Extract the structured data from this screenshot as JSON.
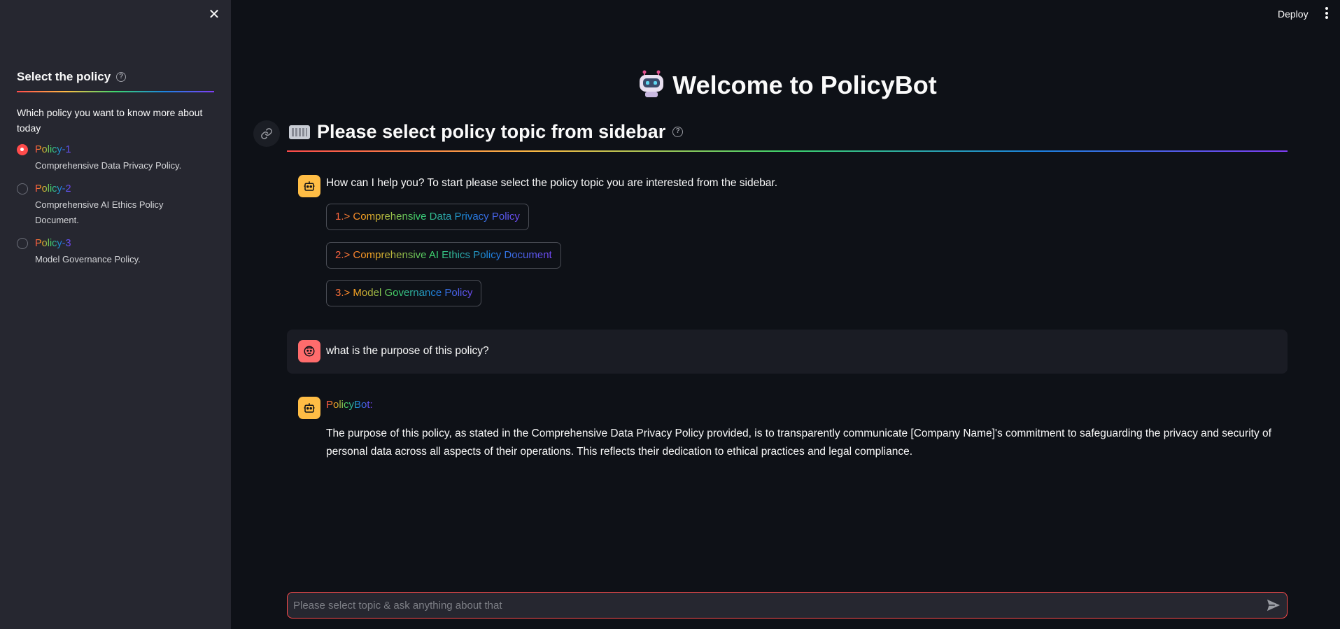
{
  "sidebar": {
    "close_label": "✕",
    "title": "Select the policy",
    "question": "Which policy you want to know more about today",
    "options": [
      {
        "label": "Policy-1",
        "caption": "Comprehensive Data Privacy Policy.",
        "selected": true
      },
      {
        "label": "Policy-2",
        "caption": "Comprehensive AI Ethics Policy Document.",
        "selected": false
      },
      {
        "label": "Policy-3",
        "caption": "Model Governance Policy.",
        "selected": false
      }
    ]
  },
  "topbar": {
    "deploy_label": "Deploy"
  },
  "main": {
    "title": "Welcome to PolicyBot",
    "subtitle": "Please select policy topic from sidebar"
  },
  "chat": {
    "greeting": "How can I help you? To start please select the policy topic you are interested from the sidebar.",
    "topics": [
      "1.> Comprehensive Data Privacy Policy",
      "2.> Comprehensive AI Ethics Policy Document",
      "3.> Model Governance Policy"
    ],
    "user_message": "what is the purpose of this policy?",
    "bot_name": "PolicyBot:",
    "bot_answer": "The purpose of this policy, as stated in the Comprehensive Data Privacy Policy provided, is to transparently communicate [Company Name]'s commitment to safeguarding the privacy and security of personal data across all aspects of their operations. This reflects their dedication to ethical practices and legal compliance."
  },
  "input": {
    "placeholder": "Please select topic & ask anything about that",
    "value": ""
  },
  "colors": {
    "accent": "#ff4b4b",
    "bot_avatar": "#ffbd45",
    "user_avatar": "#ff6c6c",
    "sidebar_bg": "#262730",
    "main_bg": "#0e1117"
  },
  "icons": {
    "close": "close-icon",
    "help": "help-icon",
    "link": "link-icon",
    "keyboard": "keyboard-icon",
    "robot": "robot-icon",
    "bot_avatar": "bot-avatar-icon",
    "user_avatar": "user-avatar-icon",
    "send": "send-icon",
    "menu": "kebab-menu-icon"
  }
}
